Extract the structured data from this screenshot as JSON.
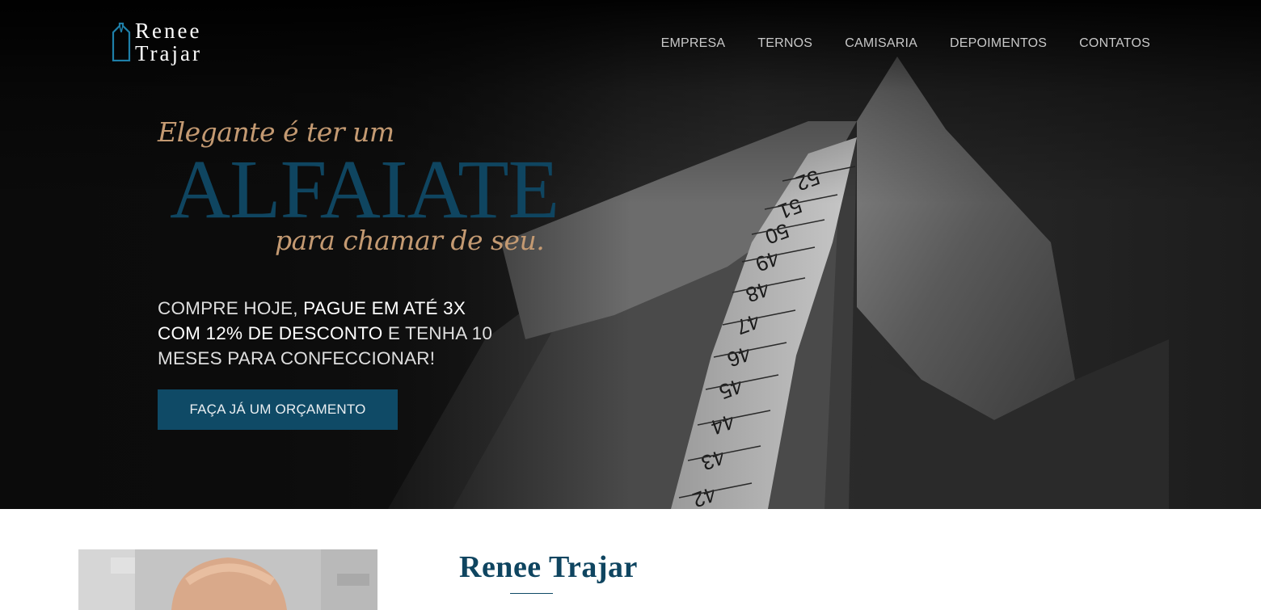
{
  "brand": {
    "line1": "Renee",
    "line2": "Trajar",
    "accent": "#1e7fa8",
    "icon": "suit-jacket-icon"
  },
  "nav": {
    "items": [
      "EMPRESA",
      "TERNOS",
      "CAMISARIA",
      "DEPOIMENTOS",
      "CONTATOS"
    ]
  },
  "hero": {
    "kicker": "Elegante é ter um",
    "headline": "ALFAIATE",
    "tagline": "para chamar de seu.",
    "promo": {
      "part1": "COMPRE HOJE, ",
      "highlight": "PAGUE EM ATÉ 3X COM 12% DE DESCONTO",
      "part2": " E TENHA 10 MESES PARA CONFECCIONAR!"
    },
    "cta_label": "FAÇA JÁ UM ORÇAMENTO",
    "tape_numbers": [
      "52",
      "51",
      "50",
      "49",
      "48",
      "47",
      "46",
      "45",
      "44",
      "43",
      "42"
    ],
    "colors": {
      "gold": "#c49a72",
      "navy": "#0f4560",
      "button": "#0f4a66"
    }
  },
  "about": {
    "title": "Renee Trajar"
  }
}
